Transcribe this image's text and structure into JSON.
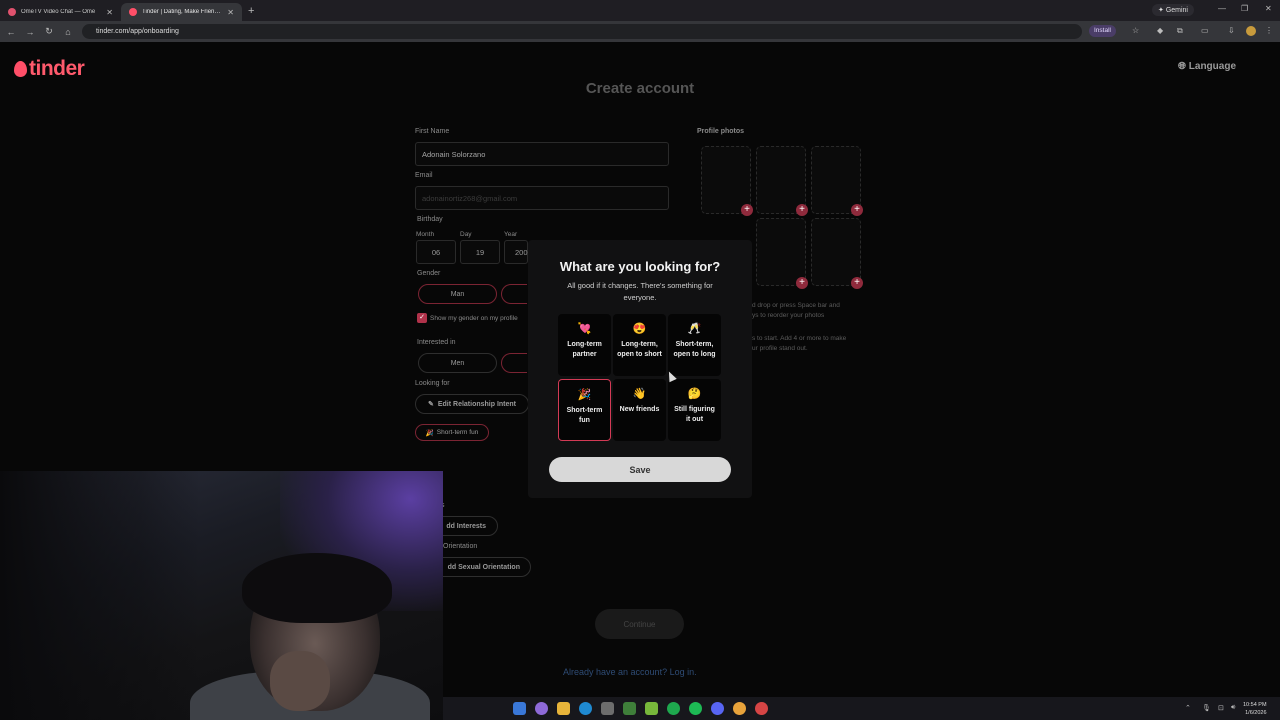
{
  "browser": {
    "tabs": [
      {
        "title": "OmeTV Video Chat — Ome",
        "active": false,
        "color": "#e0526e"
      },
      {
        "title": "Tinder | Dating, Make Friends & Meet New People",
        "active": true,
        "color": "#ff4f68"
      }
    ],
    "gemini_label": "Gemini",
    "url": "tinder.com/app/onboarding",
    "install_label": "Install"
  },
  "header": {
    "logo_text": "tinder",
    "language_label": "Language"
  },
  "form": {
    "title": "Create account",
    "first_name_label": "First Name",
    "first_name_value": "Adonain Solorzano",
    "email_label": "Email",
    "email_value": "adonainortiz268@gmail.com",
    "birthday_label": "Birthday",
    "month_label": "Month",
    "month_value": "06",
    "day_label": "Day",
    "day_value": "19",
    "year_label": "Year",
    "year_value": "200",
    "gender_label": "Gender",
    "gender_man": "Man",
    "show_gender_label": "Show my gender on my profile",
    "interested_label": "Interested in",
    "interested_men": "Men",
    "looking_for_label": "Looking for",
    "edit_intent_label": "Edit Relationship Intent",
    "intent_chip": "Short-term fun",
    "interests_label": "s",
    "add_interests_label": "dd Interests",
    "orientation_label": "Orientation",
    "add_orientation_label": "dd Sexual Orientation",
    "continue_label": "Continue",
    "login_link": "Already have an account? Log in."
  },
  "photos": {
    "label": "Profile photos",
    "note_1": "d drop or press Space bar and\nys to reorder your photos",
    "note_2": "s to start. Add 4 or more to make\nur profile stand out."
  },
  "modal": {
    "title": "What are you looking for?",
    "subtitle": "All good if it changes. There's something for everyone.",
    "options": [
      {
        "emoji": "💘",
        "label": "Long-term partner",
        "selected": false
      },
      {
        "emoji": "😍",
        "label": "Long-term, open to short",
        "selected": false
      },
      {
        "emoji": "🥂",
        "label": "Short-term, open to long",
        "selected": false
      },
      {
        "emoji": "🎉",
        "label": "Short-term fun",
        "selected": true
      },
      {
        "emoji": "👋",
        "label": "New friends",
        "selected": false
      },
      {
        "emoji": "🤔",
        "label": "Still figuring it out",
        "selected": false
      }
    ],
    "save_label": "Save"
  },
  "taskbar": {
    "time": "10:54 PM",
    "date": "1/6/2026"
  },
  "colors": {
    "brand": "#ff4f68",
    "selected_border": "#d33a55"
  }
}
